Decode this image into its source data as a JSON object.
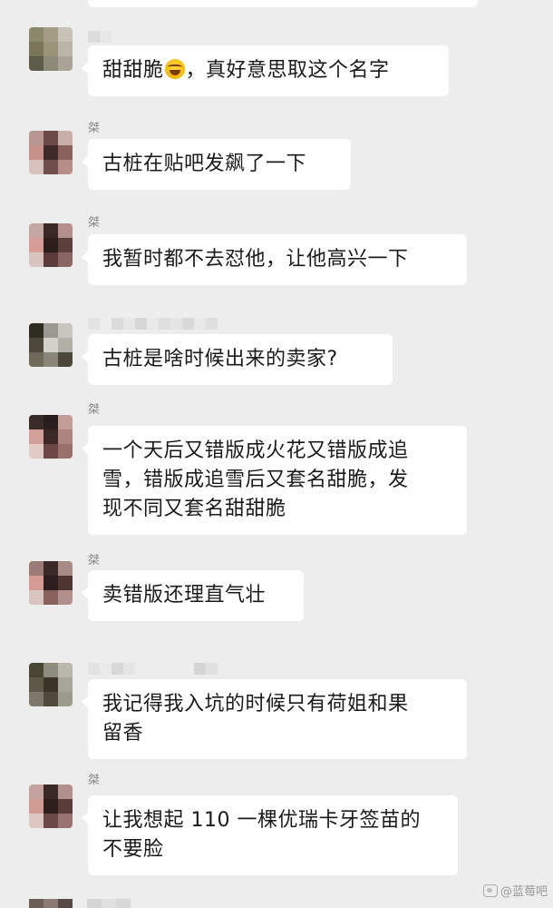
{
  "messages": [
    {
      "sender": "",
      "text_before": "甜甜脆",
      "text_after": "，真好意思取这个名字"
    },
    {
      "sender": "桀",
      "text": "古桩在贴吧发飙了一下"
    },
    {
      "sender": "桀",
      "text": "我暂时都不去怼他，让他高兴一下"
    },
    {
      "sender": "",
      "text": "古桩是啥时候出来的卖家?"
    },
    {
      "sender": "桀",
      "lines": [
        "一个天后又错版成火花又错版成追",
        "雪，错版成追雪后又套名甜脆，发",
        "现不同又套名甜甜脆"
      ]
    },
    {
      "sender": "桀",
      "text": "卖错版还理直气壮"
    },
    {
      "sender": "",
      "lines": [
        "我记得我入坑的时候只有荷姐和果",
        "留香"
      ]
    },
    {
      "sender": "桀",
      "lines": [
        "让我想起 110 一棵优瑞卡牙签苗的",
        "不要脸"
      ]
    }
  ],
  "emoji_icon": "laughing-tears-emoji",
  "watermark": {
    "icon": "camera-icon",
    "text": "@蓝莓吧"
  },
  "colors": {
    "background": "#ededed",
    "bubble": "#ffffff",
    "text": "#1a1a1a",
    "sender": "#8b8b8b"
  }
}
